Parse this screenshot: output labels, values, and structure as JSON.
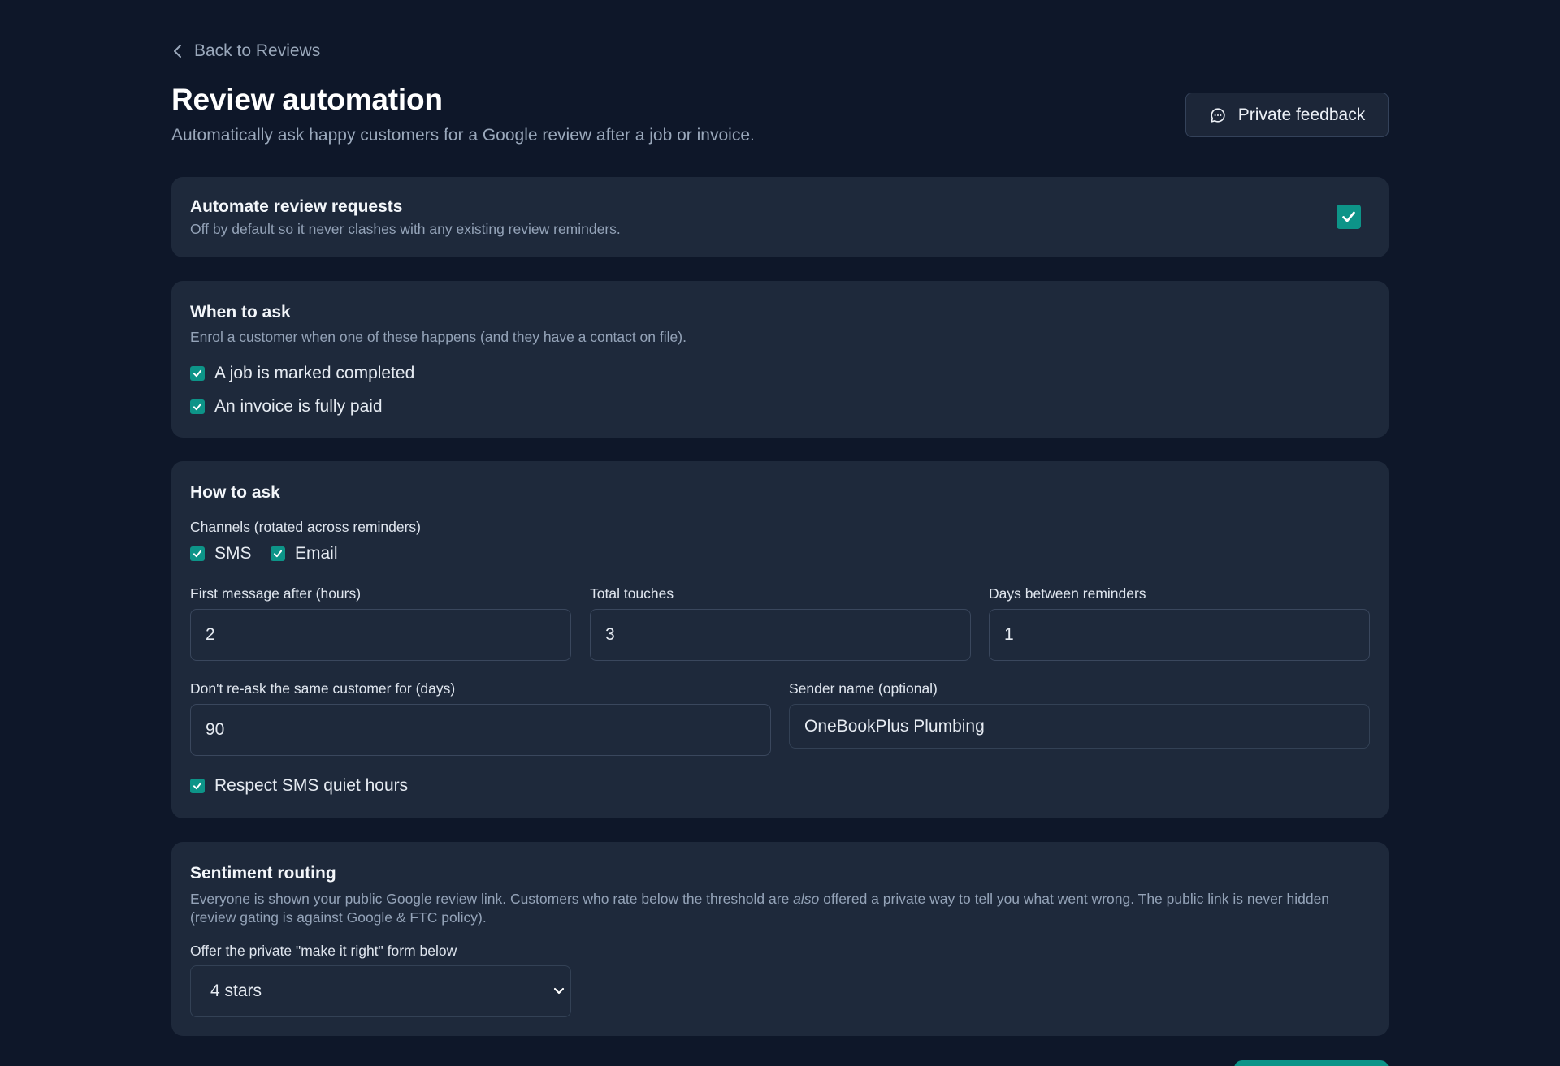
{
  "header": {
    "back_label": "Back to Reviews",
    "title": "Review automation",
    "subtitle": "Automatically ask happy customers for a Google review after a job or invoice.",
    "private_feedback_label": "Private feedback"
  },
  "automate": {
    "title": "Automate review requests",
    "description": "Off by default so it never clashes with any existing review reminders.",
    "checked": true
  },
  "when": {
    "title": "When to ask",
    "description": "Enrol a customer when one of these happens (and they have a contact on file).",
    "options": [
      {
        "label": "A job is marked completed",
        "checked": true
      },
      {
        "label": "An invoice is fully paid",
        "checked": true
      }
    ]
  },
  "how": {
    "title": "How to ask",
    "channels_label": "Channels (rotated across reminders)",
    "channels": [
      {
        "label": "SMS",
        "checked": true
      },
      {
        "label": "Email",
        "checked": true
      }
    ],
    "first_message_label": "First message after (hours)",
    "first_message_value": "2",
    "total_touches_label": "Total touches",
    "total_touches_value": "3",
    "days_between_label": "Days between reminders",
    "days_between_value": "1",
    "reask_label": "Don't re-ask the same customer for (days)",
    "reask_value": "90",
    "sender_label": "Sender name (optional)",
    "sender_value": "OneBookPlus Plumbing",
    "quiet_hours_label": "Respect SMS quiet hours",
    "quiet_hours_checked": true
  },
  "sentiment": {
    "title": "Sentiment routing",
    "desc_part1": "Everyone is shown your public Google review link. Customers who rate below the threshold are ",
    "desc_em": "also",
    "desc_part2": " offered a private way to tell you what went wrong. The public link is never hidden (review gating is against Google & FTC policy).",
    "threshold_label": "Offer the private \"make it right\" form below",
    "threshold_value": "4 stars"
  },
  "colors": {
    "background": "#0e1729",
    "card": "#1e293b",
    "accent": "#0d9488"
  }
}
